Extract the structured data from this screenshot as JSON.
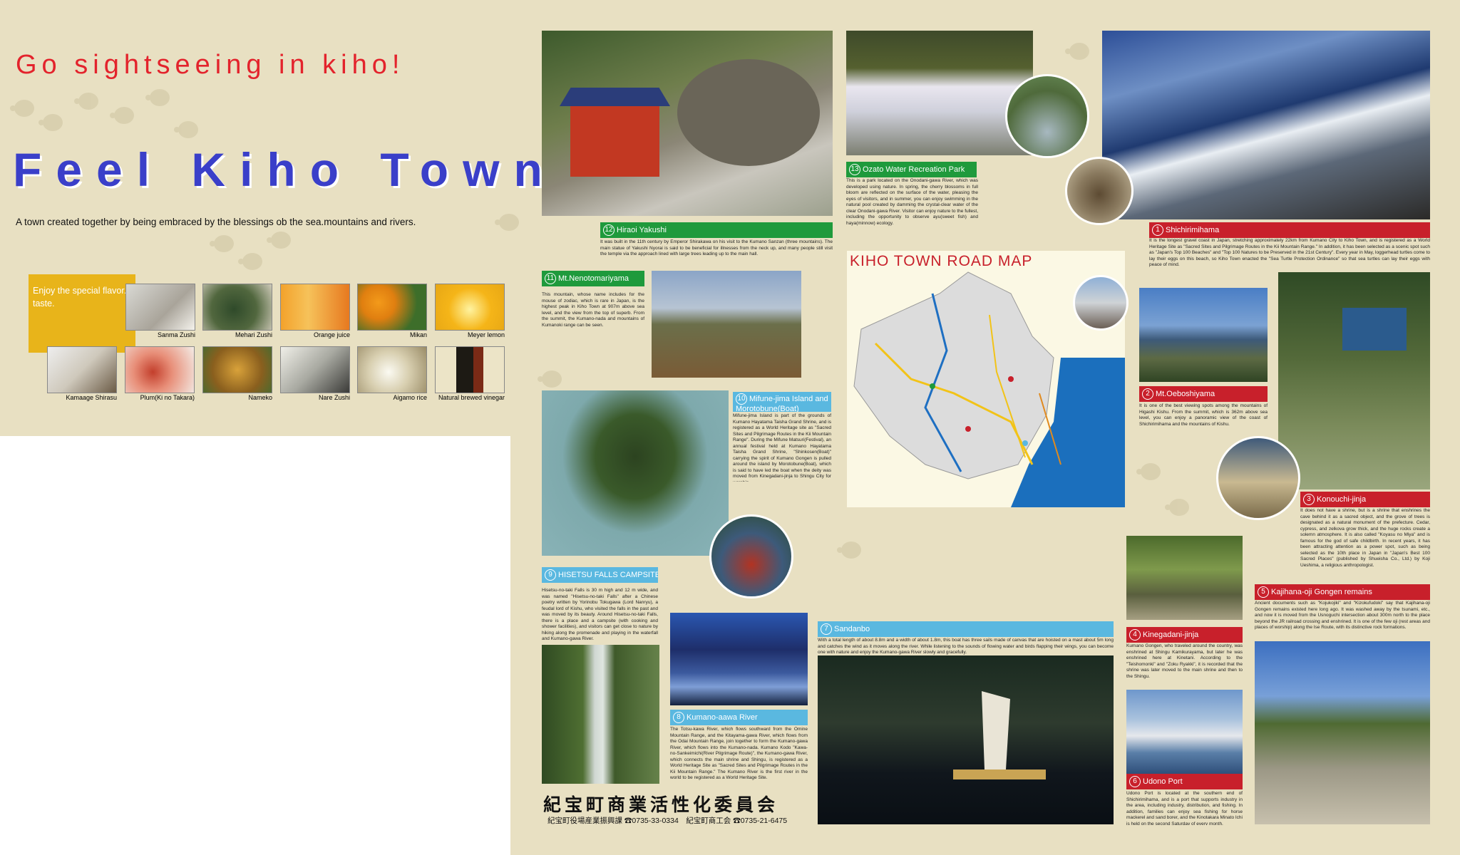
{
  "left": {
    "slogan": "Go sightseeing in kiho!",
    "title": "Feel Kiho Town",
    "subtitle": "A town created together by being embraced by the blessings ob the sea.mountains and rivers.",
    "special_box": "Enjoy the special flavor.\n taste.",
    "products_row1": [
      "Sanma Zushi",
      "Mehari Zushi",
      "Orange juice",
      "Mikan",
      "Meyer lemon"
    ],
    "products_row2": [
      "Kamaage Shirasu",
      "Plum(Ki no Takara)",
      "Nameko",
      "Nare Zushi",
      "Aigamo rice",
      "Natural brewed vinegar"
    ]
  },
  "map_title": "KIHO TOWN ROAD MAP",
  "spots": [
    {
      "num": "12",
      "name": "Hiraoi Yakushi",
      "text": "It was built in the 11th century by Emperor Shirakawa on his visit to the Kumano Sanzan (three mountains). The main statue of Yakushi Nyorai is said to be beneficial for illnesses from the neck up, and many people still visit the temple via the approach lined with large trees leading up to the main hall."
    },
    {
      "num": "13",
      "name": "Ozato Water Recreation Park",
      "text": "This is a park located on the Onodani-gawa River, which was developed using nature. In spring, the cherry blossoms in full bloom are reflected on the surface of the water, pleasing the eyes of visitors, and in summer, you can enjoy swimming in the natural pool created by damming the crystal-clear water of the clear Onodani-gawa River. Visitor can enjoy nature to the fullest, including the opportunity to observe ayu(sweet fish) and haya(minnow) ecology."
    },
    {
      "num": "1",
      "name": "Shichirimihama",
      "text": "It is the longest gravel coast in Japan, stretching approximately 22km from Kumano City to Kiho Town, and is registered as a World Heritage Site as \"Sacred Sites and Pilgrimage Routes in the Kii Mountain Range.\" In addition, it has been selected as a scenic spot such as \"Japan's Top 100 Beaches\" and \"Top 100 Natures to be Preserved in the 21st Century\". Every year in May, loggerhead turtles come to lay their eggs on this beach, so Kiho Town enacted the \"Sea Turtle Protection Ordinance\" so that sea turtles can lay their eggs with peace of mind."
    },
    {
      "num": "11",
      "name": "Mt.Nenotomariyama",
      "text": "This mountain, whose name includes for the mouse of zodiac, which is rare in Japan, is the highest peak in Kiho Town at 907m above sea level, and the view from the top of superb. From the summit, the Kumano-nada and mountains of Kumanoki range can be seen."
    },
    {
      "num": "10",
      "name": "Mifune-jima Island and Morotobune(Boat)",
      "text": "Mifune-jima Island is part of the grounds of Kumano Hayatama Taisha Grand Shrine, and is registered as a World Heritage site as \"Sacred Sites and Pilgrimage Routes in the Kii Mountain Range\". During the Mifune Matsuri(Festival), an annual festival held at Kumano Hayatama Taisha Grand Shrine, \"Shinkosen(Boat)\" carrying the spirit of Kumano Gongen is pulled around the island by Morotobune(Boat), which is said to have led the boat when the deity was moved from Kinegadani-jinja to Shingu City for worship."
    },
    {
      "num": "2",
      "name": "Mt.Oeboshiyama",
      "text": "It is one of the best viewing spots among the mountains of Higashi Kishu. From the summit, which is 362m above sea level, you can enjoy a panoramic view of the coast of Shichirimihama and the mountains of Kishu."
    },
    {
      "num": "3",
      "name": "Konouchi-jinja",
      "text": "It does not have a shrine, but is a shrine that enshrines the cave behind it as a sacred object, and the grove of trees is designated as a natural monument of the prefecture. Cedar, cypress, and zelkova grow thick, and the huge rocks create a solemn atmosphere. It is also called \"Koyasu no Miya\" and is famous for the god of safe childbirth. In recent years, it has been attracting attention as a power spot, such as being selected as the 10th place in Japan in \"Japan's Best 100 Sacred Places\" (published by Shueisha Co., Ltd.) by Koji Ueshima, a religious anthropologist."
    },
    {
      "num": "9",
      "name": "HISETSU FALLS CAMPSITE",
      "text": "Hisetsu-no-taki Falls is 30 m high and 12 m wide, and was named \"Hisetsu-no-taki Falls\" after a Chinese poetry written by Yorinobu Tokugawa (Lord Nanryu), a feudal lord of Kishu, who visited the falls in the past and was moved by its beauty. Around Hisetsu-no-taki Falls, there is a place and a campsite (with cooking and shower facilities), and visitors can get close to nature by hiking along the promenade and playing in the waterfall and Kumano-gawa River."
    },
    {
      "num": "5",
      "name": "Kajihana-oji Gongen remains",
      "text": "Ancient documents such as \"Kojukojiki\" and \"Kizokufudoki\" say that Kajihana-oji Gongen remains existed here long ago. It was washed away by the tsunami, etc., and now it is moved from the Usnoguchi intersection about 300m north to the place beyond the JR railroad crossing and enshrined. It is one of the few oji (rest areas and places of worship) along the Ise Route, with its distinctive rock formations."
    },
    {
      "num": "7",
      "name": "Sandanbo",
      "text": "With a total length of about 8.8m and a width of about 1.8m, this boat has three sails made of canvas that are hoisted on a mast about 5m long and catches the wind as it moves along the river. While listening to the sounds of flowing water and birds flapping their wings, you can become one with nature and enjoy the Kumano-gawa River slowly and gracefully."
    },
    {
      "num": "4",
      "name": "Kinegadani-jinja",
      "text": "Kumano Gongen, who traveled around the country, was enshrined at Shingu Kamikurayama, but later he was enshrined here at Kinetani. According to the \"Teishomonki\" and \"Zoku Ryakki\", it is recorded that the shrine was later moved to the main shrine and then to the Shingu."
    },
    {
      "num": "8",
      "name": "Kumano-aawa River",
      "text": "The Totsu-kawa River, which flows southward from the Omine Mountain Range, and the Kitayama-gawa River, which flows from the Odai Mountain Range, join together to form the Kumano-gawa River, which flows into the Kumano-nada. Kumano Kodo \"Kawa-no-Sankeimichi(River Pilgrimage Route)\", the Kumano-gawa River, which connects the main shrine and Shingu, is registered as a World Heritage Site as \"Sacred Sites and Pilgrimage Routes in the Kii Mountain Range.\" The Kumano River is the first river in the world to be registered as a World Heritage Site."
    },
    {
      "num": "6",
      "name": "Udono Port",
      "text": "Udono Port is located at the southern end of Shichirimihama, and is a port that supports industry in the area, including industry, distribution, and fishing. In addition, families can enjoy sea fishing for horse mackerel and sand borer, and the Kinotakara Minato Ichi is held on the second Saturday of every month."
    }
  ],
  "footer": {
    "org": "紀宝町商業活性化委員会",
    "contact": "紀宝町役場産業振興課 ☎0735-33-0334　紀宝町商工会 ☎0735-21-6475"
  },
  "colors": {
    "green": "#1f9a3c",
    "red": "#c8202b",
    "blue": "#5ab8e0",
    "bg": "#e8e0c2",
    "title_blue": "#3a3fc9",
    "slogan_red": "#e3232c"
  }
}
